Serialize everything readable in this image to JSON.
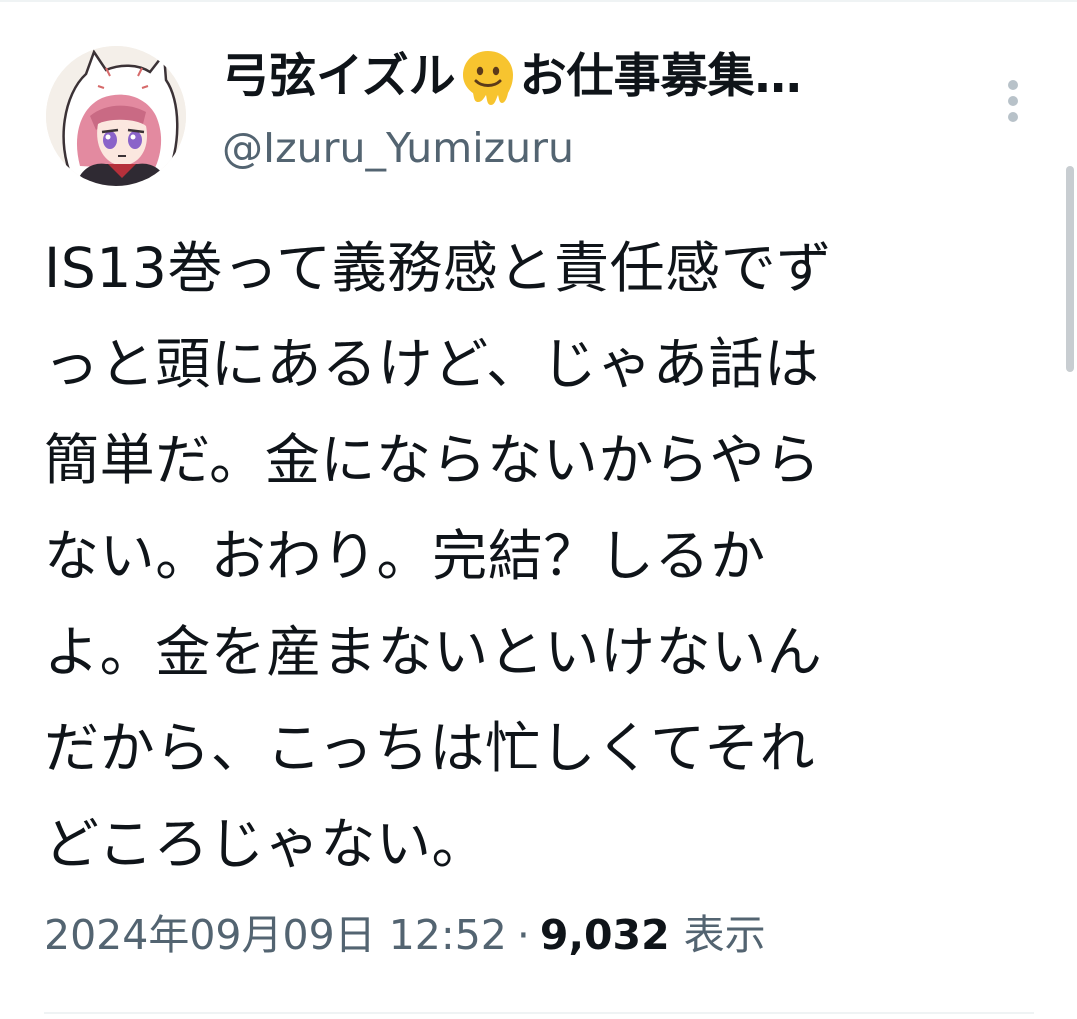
{
  "tweet": {
    "author": {
      "name_part1": "弓弦イズル",
      "name_emoji": "melting-face-emoji",
      "name_part2": "お仕事募集…",
      "handle": "@Izuru_Yumizuru"
    },
    "text_lines": [
      "IS13巻って義務感と責任感でず",
      "っと頭にあるけど、じゃあ話は",
      "簡単だ。金にならないからやら",
      "ない。おわり。完結？しるか",
      "よ。金を産まないといけないん",
      "だから、こっちは忙しくてそれ",
      "どころじゃない。"
    ],
    "timestamp": "2024年09月09日 12:52",
    "separator": "·",
    "view_count": "9,032",
    "views_label": "表示"
  },
  "colors": {
    "text_primary": "#0f1419",
    "text_secondary": "#536471",
    "divider": "#eff3f4"
  },
  "icons": {
    "more": "more-vertical-icon",
    "emoji": "melting-face-emoji"
  }
}
